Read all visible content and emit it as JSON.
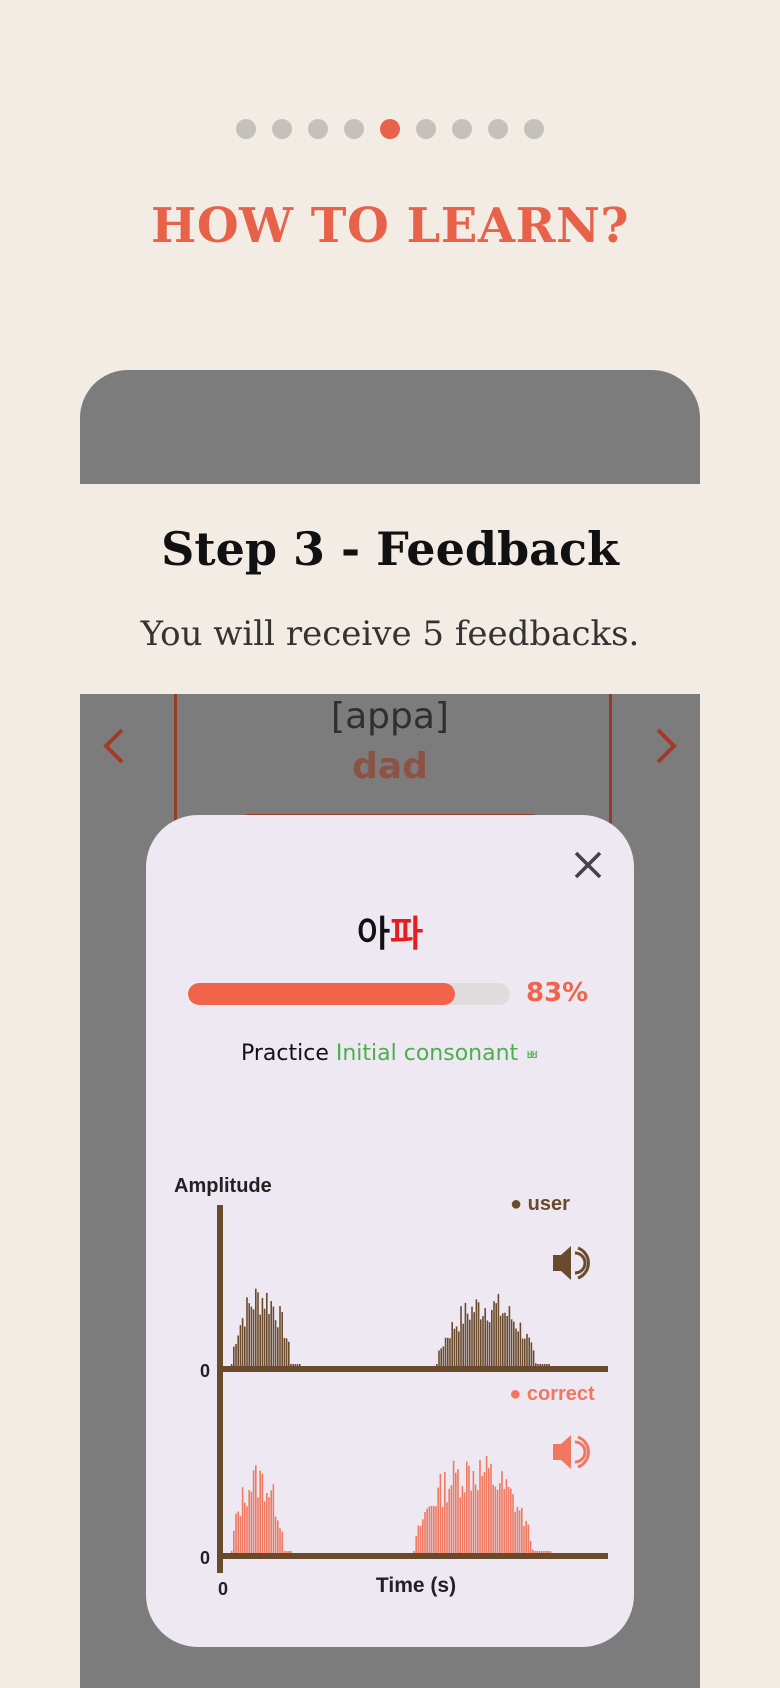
{
  "pagination": {
    "total": 9,
    "active_index": 4
  },
  "page_title": "HOW TO LEARN?",
  "step": {
    "title": "Step 3 - Feedback",
    "description": "You will receive 5 feedbacks."
  },
  "card": {
    "romanization": "[appa]",
    "meaning": "dad"
  },
  "modal": {
    "word_part1": "아",
    "word_part2": "파",
    "progress_percent": 83,
    "progress_text": "83%",
    "practice_prefix": "Practice",
    "practice_target": "Initial consonant",
    "practice_jamo": "ㅃ"
  },
  "chart": {
    "y_label": "Amplitude",
    "x_label": "Time (s)",
    "x_tick": "0",
    "user_y_tick": "0",
    "correct_y_tick": "0",
    "legend_user": "● user",
    "legend_correct": "● correct",
    "user_color": "#6a4a2c",
    "correct_color": "#f07860"
  },
  "chart_data": {
    "type": "area",
    "title": "",
    "xlabel": "Time (s)",
    "ylabel": "Amplitude",
    "series": [
      {
        "name": "user",
        "segments": [
          [
            0.02,
            0.2,
            0.8
          ],
          [
            0.56,
            0.86,
            0.7
          ]
        ]
      },
      {
        "name": "correct",
        "segments": [
          [
            0.02,
            0.18,
            0.85
          ],
          [
            0.5,
            0.86,
            0.95
          ]
        ]
      }
    ]
  }
}
